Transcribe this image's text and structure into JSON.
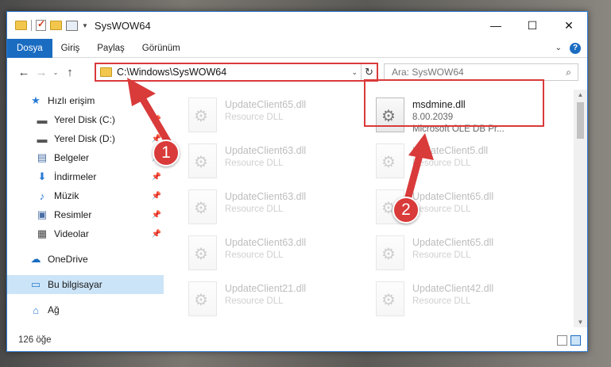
{
  "window": {
    "title": "SysWOW64",
    "controls": {
      "minimize": "—",
      "maximize": "☐",
      "close": "✕"
    }
  },
  "ribbon": {
    "tabs": [
      "Dosya",
      "Giriş",
      "Paylaş",
      "Görünüm"
    ],
    "expand": "⌄",
    "help": "?"
  },
  "nav": {
    "back": "←",
    "forward": "→",
    "recent": "⌄",
    "up": "↑",
    "address": "C:\\Windows\\SysWOW64",
    "address_dropdown": "⌄",
    "refresh": "↻",
    "search_placeholder": "Ara: SysWOW64",
    "search_icon": "⌕"
  },
  "sidebar": {
    "items": [
      {
        "label": "Hızlı erişim",
        "icon": "star-icon",
        "glyph": "★",
        "pinned": false
      },
      {
        "label": "Yerel Disk (C:)",
        "icon": "drive-icon",
        "glyph": "▬",
        "pinned": true
      },
      {
        "label": "Yerel Disk (D:)",
        "icon": "drive-icon",
        "glyph": "▬",
        "pinned": true
      },
      {
        "label": "Belgeler",
        "icon": "documents-icon",
        "glyph": "▤",
        "pinned": true
      },
      {
        "label": "İndirmeler",
        "icon": "download-icon",
        "glyph": "⬇",
        "pinned": true
      },
      {
        "label": "Müzik",
        "icon": "music-icon",
        "glyph": "♪",
        "pinned": true
      },
      {
        "label": "Resimler",
        "icon": "pictures-icon",
        "glyph": "▣",
        "pinned": true
      },
      {
        "label": "Videolar",
        "icon": "video-icon",
        "glyph": "▦",
        "pinned": true
      },
      {
        "label": "OneDrive",
        "icon": "cloud-icon",
        "glyph": "☁",
        "pinned": false
      },
      {
        "label": "Bu bilgisayar",
        "icon": "computer-icon",
        "glyph": "▭",
        "pinned": false
      },
      {
        "label": "Ağ",
        "icon": "network-icon",
        "glyph": "⌂",
        "pinned": false
      }
    ],
    "pin_glyph": "📌"
  },
  "files": [
    {
      "name": "UpdateClient65.dll",
      "desc": "Resource DLL"
    },
    {
      "name": "msdmine.dll",
      "desc": "8.00.2039",
      "desc2": "Microsoft OLE DB Pr...",
      "highlighted": true
    },
    {
      "name": "UpdateClient63.dll",
      "desc": "Resource DLL"
    },
    {
      "name": "UpdateClient5.dll",
      "desc": "Resource DLL"
    },
    {
      "name": "UpdateClient63.dll",
      "desc": "Resource DLL"
    },
    {
      "name": "UpdateClient65.dll",
      "desc": "Resource DLL"
    },
    {
      "name": "UpdateClient63.dll",
      "desc": "Resource DLL"
    },
    {
      "name": "UpdateClient65.dll",
      "desc": "Resource DLL"
    },
    {
      "name": "UpdateClient21.dll",
      "desc": "Resource DLL"
    },
    {
      "name": "UpdateClient42.dll",
      "desc": "Resource DLL"
    }
  ],
  "status": {
    "count": "126 öğe"
  },
  "annotations": {
    "badge1": "1",
    "badge2": "2"
  },
  "colors": {
    "accent": "#1a6cc1",
    "highlight": "#d93a3a",
    "selection": "#cce4f7"
  }
}
